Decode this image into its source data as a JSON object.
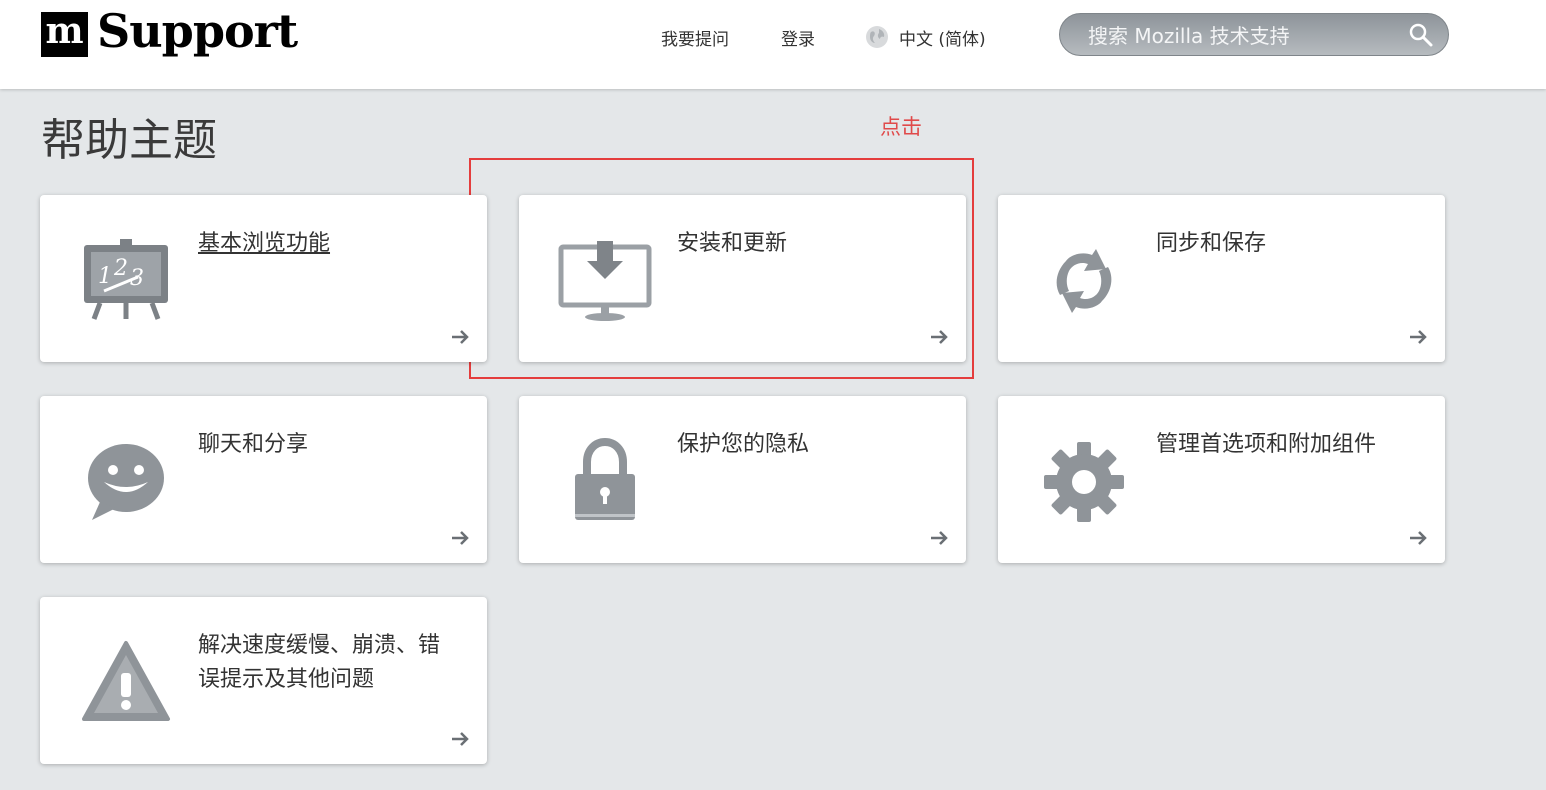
{
  "header": {
    "logo_mark": "m",
    "logo_text": "Support",
    "nav": {
      "ask": "我要提问",
      "login": "登录",
      "language": "中文 (简体)"
    },
    "search": {
      "placeholder": "搜索 Mozilla 技术支持",
      "value": ""
    }
  },
  "page_title": "帮助主题",
  "annotation": {
    "text": "点击",
    "color": "#e43d3d"
  },
  "topics": [
    {
      "label": "基本浏览功能",
      "icon": "easel-123-icon"
    },
    {
      "label": "安装和更新",
      "icon": "monitor-download-icon"
    },
    {
      "label": "同步和保存",
      "icon": "sync-icon"
    },
    {
      "label": "聊天和分享",
      "icon": "chat-bubble-icon"
    },
    {
      "label": "保护您的隐私",
      "icon": "padlock-icon"
    },
    {
      "label": "管理首选项和附加组件",
      "icon": "gear-icon"
    },
    {
      "label": "解决速度缓慢、崩溃、错误提示及其他问题",
      "icon": "warning-icon"
    }
  ]
}
